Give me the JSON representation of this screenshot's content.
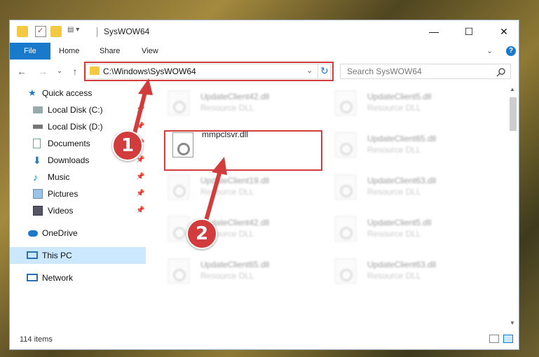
{
  "window": {
    "title": "SysWOW64",
    "minimize_glyph": "—",
    "maximize_glyph": "☐",
    "close_glyph": "✕"
  },
  "ribbon": {
    "tabs": [
      "File",
      "Home",
      "Share",
      "View"
    ],
    "help_glyph": "?",
    "expand_glyph": "⌄"
  },
  "address": {
    "path": "C:\\Windows\\SysWOW64",
    "back_glyph": "←",
    "forward_glyph": "→",
    "recent_glyph": "⌄",
    "up_glyph": "↑",
    "dropdown_glyph": "⌄",
    "refresh_glyph": "↻"
  },
  "search": {
    "placeholder": "Search SysWOW64",
    "icon": "search-icon"
  },
  "sidebar": {
    "items": [
      {
        "label": "Quick access",
        "icon": "star-icon"
      },
      {
        "label": "Local Disk (C:)",
        "icon": "drive-icon"
      },
      {
        "label": "Local Disk (D:)",
        "icon": "drive-icon"
      },
      {
        "label": "Documents",
        "icon": "documents-icon"
      },
      {
        "label": "Downloads",
        "icon": "download-icon"
      },
      {
        "label": "Music",
        "icon": "music-icon"
      },
      {
        "label": "Pictures",
        "icon": "pictures-icon"
      },
      {
        "label": "Videos",
        "icon": "videos-icon"
      },
      {
        "label": "OneDrive",
        "icon": "cloud-icon"
      },
      {
        "label": "This PC",
        "icon": "computer-icon"
      },
      {
        "label": "Network",
        "icon": "network-icon"
      }
    ]
  },
  "files": {
    "highlighted": {
      "name": "mmpclsvr.dll"
    },
    "items": [
      {
        "name": "UpdateClient42.dll",
        "desc": "Resource DLL"
      },
      {
        "name": "UpdateClient5.dll",
        "desc": "Resource DLL"
      },
      {
        "name": "UpdateClient65.dll",
        "desc": "Resource DLL"
      },
      {
        "name": "UpdateClient19.dll",
        "desc": "Resource DLL"
      },
      {
        "name": "UpdateClient63.dll",
        "desc": "Resource DLL"
      },
      {
        "name": "UpdateClient42.dll",
        "desc": "Resource DLL"
      },
      {
        "name": "UpdateClient5.dll",
        "desc": "Resource DLL"
      },
      {
        "name": "UpdateClient65.dll",
        "desc": "Resource DLL"
      },
      {
        "name": "UpdateClient63.dll",
        "desc": "Resource DLL"
      }
    ]
  },
  "status": {
    "count": "114 items"
  },
  "callouts": [
    "1",
    "2"
  ],
  "colors": {
    "accent": "#1979ca",
    "highlight": "#d33c3c",
    "selected": "#cce8ff"
  }
}
